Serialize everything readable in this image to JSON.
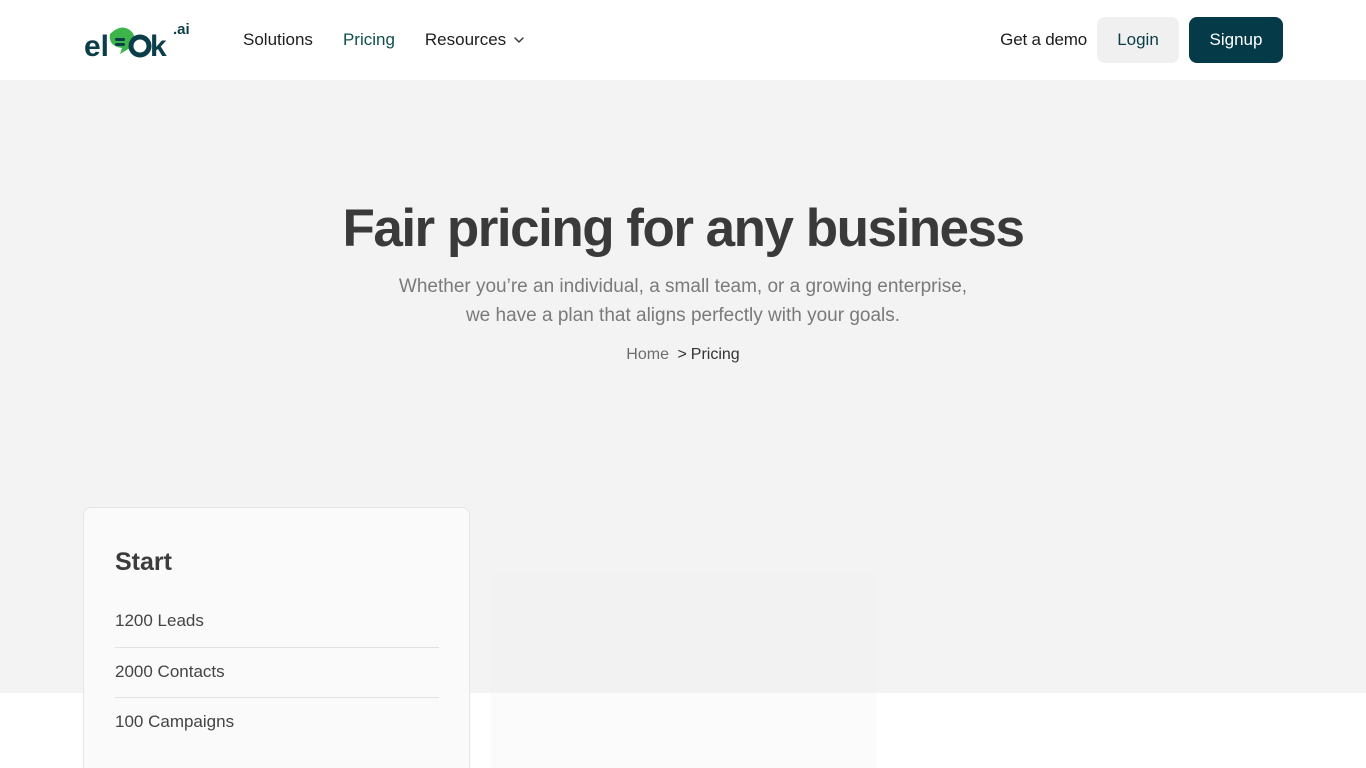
{
  "brand": {
    "logo_text": "elook.ai",
    "accent_color": "#0f4f4f",
    "logo_green": "#3db54a",
    "logo_dark": "#0c3d4a"
  },
  "nav": {
    "items": [
      {
        "label": "Solutions",
        "active": false
      },
      {
        "label": "Pricing",
        "active": true
      },
      {
        "label": "Resources",
        "active": false,
        "has_dropdown": true
      }
    ]
  },
  "actions": {
    "demo_label": "Get a demo",
    "login_label": "Login",
    "signup_label": "Signup",
    "signup_color": "#053a48"
  },
  "hero": {
    "title": "Fair pricing for any business",
    "subtitle_line1": "Whether you’re an individual, a small team, or a growing enterprise,",
    "subtitle_line2": "we have a plan that aligns perfectly with your goals."
  },
  "breadcrumb": {
    "home": "Home",
    "separator": ">",
    "current": "Pricing"
  },
  "plans": [
    {
      "name": "Start",
      "features": [
        "1200 Leads",
        "2000 Contacts",
        "100 Campaigns"
      ]
    }
  ]
}
